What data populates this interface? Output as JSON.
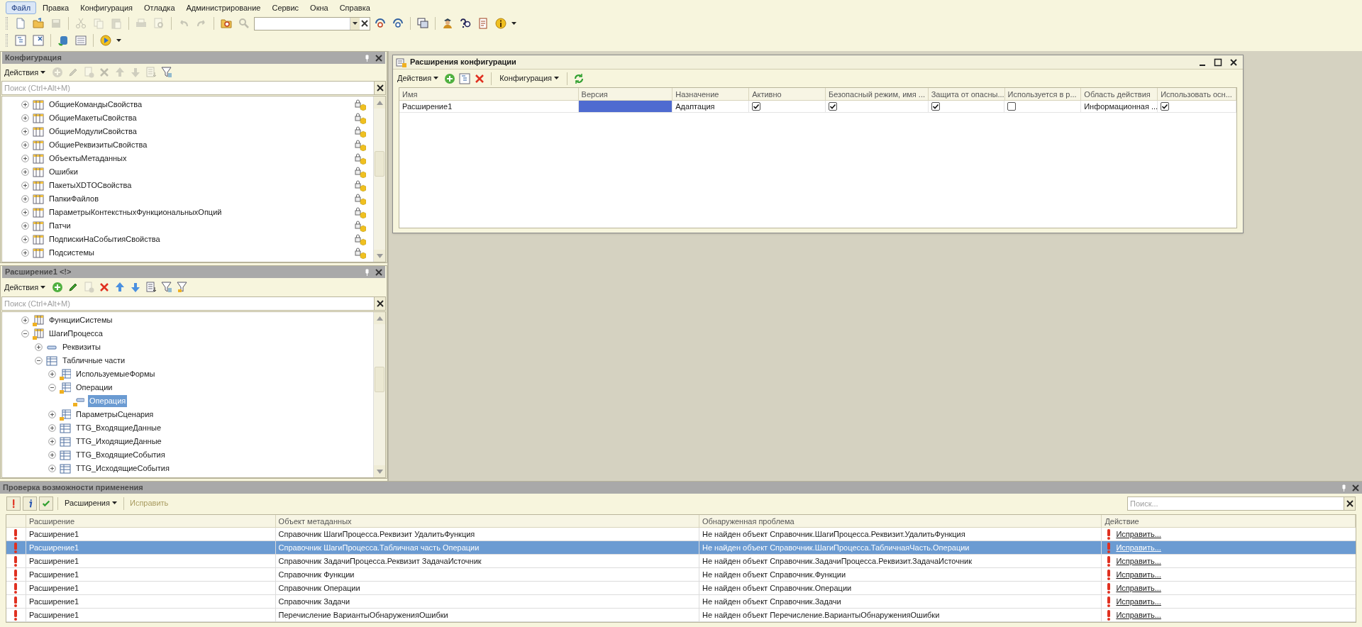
{
  "menu": [
    {
      "label": "Файл",
      "selected": true
    },
    {
      "label": "Правка",
      "selected": false
    },
    {
      "label": "Конфигурация",
      "selected": false
    },
    {
      "label": "Отладка",
      "selected": false
    },
    {
      "label": "Администрирование",
      "selected": false
    },
    {
      "label": "Сервис",
      "selected": false
    },
    {
      "label": "Окна",
      "selected": false
    },
    {
      "label": "Справка",
      "selected": false
    }
  ],
  "toolbar_1": [
    {
      "kind": "doc",
      "disabled": false
    },
    {
      "kind": "folder",
      "disabled": false
    },
    {
      "kind": "save",
      "disabled": true
    },
    {
      "kind": "separator"
    },
    {
      "kind": "cut",
      "disabled": true
    },
    {
      "kind": "copy",
      "disabled": true
    },
    {
      "kind": "paste",
      "disabled": true
    },
    {
      "kind": "separator"
    },
    {
      "kind": "print",
      "disabled": true
    },
    {
      "kind": "preview",
      "disabled": true
    },
    {
      "kind": "separator"
    },
    {
      "kind": "undo",
      "disabled": true
    },
    {
      "kind": "redo",
      "disabled": true
    },
    {
      "kind": "separator"
    },
    {
      "kind": "findfolder",
      "disabled": false
    },
    {
      "kind": "search",
      "disabled": true
    },
    {
      "kind": "combo"
    },
    {
      "kind": "findnext",
      "disabled": false
    },
    {
      "kind": "findprev",
      "disabled": false
    },
    {
      "kind": "separator"
    },
    {
      "kind": "windows",
      "disabled": false
    },
    {
      "kind": "separator"
    },
    {
      "kind": "person",
      "disabled": false
    },
    {
      "kind": "helpsearch",
      "disabled": false
    },
    {
      "kind": "book",
      "disabled": false
    },
    {
      "kind": "info",
      "disabled": false
    },
    {
      "kind": "dropdown"
    }
  ],
  "toolbar_2": [
    {
      "kind": "tree",
      "disabled": false
    },
    {
      "kind": "treex",
      "disabled": false
    },
    {
      "kind": "separator"
    },
    {
      "kind": "db",
      "disabled": false
    },
    {
      "kind": "list",
      "disabled": false
    },
    {
      "kind": "separator"
    },
    {
      "kind": "play",
      "disabled": false
    },
    {
      "kind": "dropdown"
    }
  ],
  "config_panel": {
    "title": "Конфигурация",
    "actions": "Действия",
    "tools": [
      {
        "kind": "add",
        "disabled": true
      },
      {
        "kind": "edit",
        "disabled": true
      },
      {
        "kind": "copyadd",
        "disabled": true
      },
      {
        "kind": "delete",
        "disabled": true
      },
      {
        "kind": "up",
        "disabled": true
      },
      {
        "kind": "down",
        "disabled": true
      },
      {
        "kind": "sort",
        "disabled": true
      },
      {
        "kind": "filter",
        "disabled": false
      }
    ],
    "search": {
      "placeholder": "Поиск (Ctrl+Alt+M)"
    },
    "tree": [
      {
        "label": "ОбщиеКомандыСвойства",
        "expanded": false,
        "locked": true
      },
      {
        "label": "ОбщиеМакетыСвойства",
        "expanded": false,
        "locked": true
      },
      {
        "label": "ОбщиеМодулиСвойства",
        "expanded": false,
        "locked": true
      },
      {
        "label": "ОбщиеРеквизитыСвойства",
        "expanded": false,
        "locked": true
      },
      {
        "label": "ОбъектыМетаданных",
        "expanded": false,
        "locked": true
      },
      {
        "label": "Ошибки",
        "expanded": false,
        "locked": true
      },
      {
        "label": "ПакетыXDTOСвойства",
        "expanded": false,
        "locked": true
      },
      {
        "label": "ПапкиФайлов",
        "expanded": false,
        "locked": true
      },
      {
        "label": "ПараметрыКонтекстныхФункциональныхОпций",
        "expanded": false,
        "locked": true
      },
      {
        "label": "Патчи",
        "expanded": false,
        "locked": true
      },
      {
        "label": "ПодпискиНаСобытияСвойства",
        "expanded": false,
        "locked": true
      },
      {
        "label": "Подсистемы",
        "expanded": false,
        "locked": true
      }
    ]
  },
  "extension_panel": {
    "title": "Расширение1 <!>",
    "actions": "Действия",
    "tools": [
      {
        "kind": "add",
        "disabled": false
      },
      {
        "kind": "edit",
        "disabled": false
      },
      {
        "kind": "copyadd",
        "disabled": true
      },
      {
        "kind": "delete",
        "disabled": false
      },
      {
        "kind": "up",
        "disabled": false
      },
      {
        "kind": "down",
        "disabled": false
      },
      {
        "kind": "sort",
        "disabled": false
      },
      {
        "kind": "filter",
        "disabled": false
      },
      {
        "kind": "filterown",
        "disabled": false
      }
    ],
    "search": {
      "placeholder": "Поиск (Ctrl+Alt+M)"
    },
    "tree": [
      {
        "label": "ФункцииСистемы",
        "kind": "adopted-catalog",
        "expanded": false,
        "selected": false
      },
      {
        "label": "ШагиПроцесса",
        "kind": "adopted-catalog",
        "expanded": true,
        "selected": false,
        "children": [
          {
            "label": "Реквизиты",
            "kind": "attributes",
            "expanded": false,
            "selected": false
          },
          {
            "label": "Табличные части",
            "kind": "tables",
            "expanded": true,
            "selected": false,
            "children": [
              {
                "label": "ИспользуемыеФормы",
                "kind": "adopted-table",
                "expanded": false,
                "selected": false
              },
              {
                "label": "Операции",
                "kind": "adopted-table",
                "expanded": true,
                "selected": false,
                "children": [
                  {
                    "label": "Операция",
                    "kind": "adopted-attribute",
                    "selected": true
                  }
                ]
              },
              {
                "label": "ПараметрыСценария",
                "kind": "adopted-table",
                "expanded": false,
                "selected": false
              },
              {
                "label": "TTG_ВходящиеДанные",
                "kind": "table",
                "expanded": false,
                "selected": false
              },
              {
                "label": "TTG_ИходящиеДанные",
                "kind": "table",
                "expanded": false,
                "selected": false
              },
              {
                "label": "TTG_ВходящиеСобытия",
                "kind": "table",
                "expanded": false,
                "selected": false
              },
              {
                "label": "TTG_ИсходящиеСобытия",
                "kind": "table",
                "expanded": false,
                "selected": false
              }
            ]
          }
        ]
      }
    ]
  },
  "extensions_window": {
    "title": "Расширения конфигурации",
    "actions": "Действия",
    "config_menu": "Конфигурация",
    "columns": [
      "Имя",
      "Версия",
      "Назначение",
      "Активно",
      "Безопасный режим, имя ...",
      "Защита от опасны...",
      "Используется в р...",
      "Область действия",
      "Использовать осн..."
    ],
    "rows": [
      {
        "cells": [
          {
            "kind": "text",
            "text": "Расширение1"
          },
          {
            "kind": "empty",
            "selected": true
          },
          {
            "kind": "text",
            "text": "Адаптация"
          },
          {
            "kind": "check",
            "checked": true
          },
          {
            "kind": "check",
            "checked": true
          },
          {
            "kind": "check",
            "checked": true
          },
          {
            "kind": "check",
            "checked": false
          },
          {
            "kind": "text",
            "text": "Информационная ..."
          },
          {
            "kind": "check",
            "checked": true
          }
        ]
      }
    ]
  },
  "check_panel": {
    "title": "Проверка возможности применения",
    "filters": [
      {
        "kind": "error",
        "on": true
      },
      {
        "kind": "info",
        "on": true
      },
      {
        "kind": "ok",
        "on": true
      }
    ],
    "extensions_menu": "Расширения",
    "fix_button": {
      "label": "Исправить",
      "disabled": true
    },
    "search": {
      "placeholder": "Поиск..."
    },
    "columns": [
      "Расширение",
      "Объект метаданных",
      "Обнаруженная проблема",
      "Действие"
    ],
    "rows": [
      {
        "selected": false,
        "extension": "Расширение1",
        "object": "Справочник ШагиПроцесса.Реквизит УдалитьФункция",
        "problem": "Не найден объект Справочник.ШагиПроцесса.Реквизит.УдалитьФункция",
        "action": "Исправить..."
      },
      {
        "selected": true,
        "extension": "Расширение1",
        "object": "Справочник ШагиПроцесса.Табличная часть Операции",
        "problem": "Не найден объект Справочник.ШагиПроцесса.ТабличнаяЧасть.Операции",
        "action": "Исправить..."
      },
      {
        "selected": false,
        "extension": "Расширение1",
        "object": "Справочник ЗадачиПроцесса.Реквизит ЗадачаИсточник",
        "problem": "Не найден объект Справочник.ЗадачиПроцесса.Реквизит.ЗадачаИсточник",
        "action": "Исправить..."
      },
      {
        "selected": false,
        "extension": "Расширение1",
        "object": "Справочник Функции",
        "problem": "Не найден объект Справочник.Функции",
        "action": "Исправить..."
      },
      {
        "selected": false,
        "extension": "Расширение1",
        "object": "Справочник Операции",
        "problem": "Не найден объект Справочник.Операции",
        "action": "Исправить..."
      },
      {
        "selected": false,
        "extension": "Расширение1",
        "object": "Справочник Задачи",
        "problem": "Не найден объект Справочник.Задачи",
        "action": "Исправить..."
      },
      {
        "selected": false,
        "extension": "Расширение1",
        "object": "Перечисление ВариантыОбнаруженияОшибки",
        "problem": "Не найден объект Перечисление.ВариантыОбнаруженияОшибки",
        "action": "Исправить..."
      }
    ]
  }
}
